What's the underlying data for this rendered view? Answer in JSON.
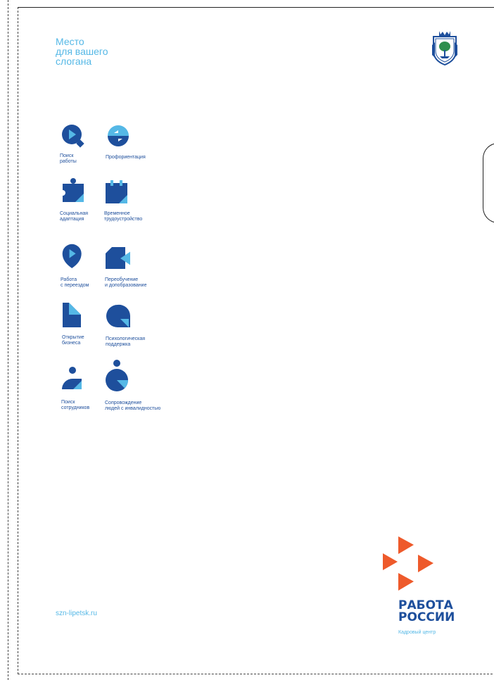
{
  "slogan": {
    "line1": "Место",
    "line2": "для вашего",
    "line3": "слогана"
  },
  "services": [
    {
      "icon": "search-play-icon",
      "line1": "Поиск",
      "line2": "работы"
    },
    {
      "icon": "cycle-arrows-icon",
      "line1": "Профориентация",
      "line2": ""
    },
    {
      "icon": "puzzle-icon",
      "line1": "Социальная",
      "line2": "адаптация"
    },
    {
      "icon": "calendar-icon",
      "line1": "Временное",
      "line2": "трудоустройство"
    },
    {
      "icon": "location-pin-icon",
      "line1": "Работа",
      "line2": "с переездом"
    },
    {
      "icon": "video-camera-icon",
      "line1": "Переобучение",
      "line2": "и допобразование"
    },
    {
      "icon": "document-icon",
      "line1": "Открытие",
      "line2": "бизнеса"
    },
    {
      "icon": "speech-bubble-icon",
      "line1": "Психологическая",
      "line2": "поддержка"
    },
    {
      "icon": "person-icon",
      "line1": "Поиск",
      "line2": "сотрудников"
    },
    {
      "icon": "person-support-icon",
      "line1": "Сопровождение",
      "line2": "людей с инвалидностью"
    }
  ],
  "website": "szn-lipetsk.ru",
  "brand": {
    "title_line1": "РАБОТА",
    "title_line2": "РОССИИ",
    "subtitle": "Кадровый центр"
  },
  "colors": {
    "dark_blue": "#1e4f9c",
    "light_blue": "#55b8e6",
    "orange": "#ee5a2b"
  }
}
